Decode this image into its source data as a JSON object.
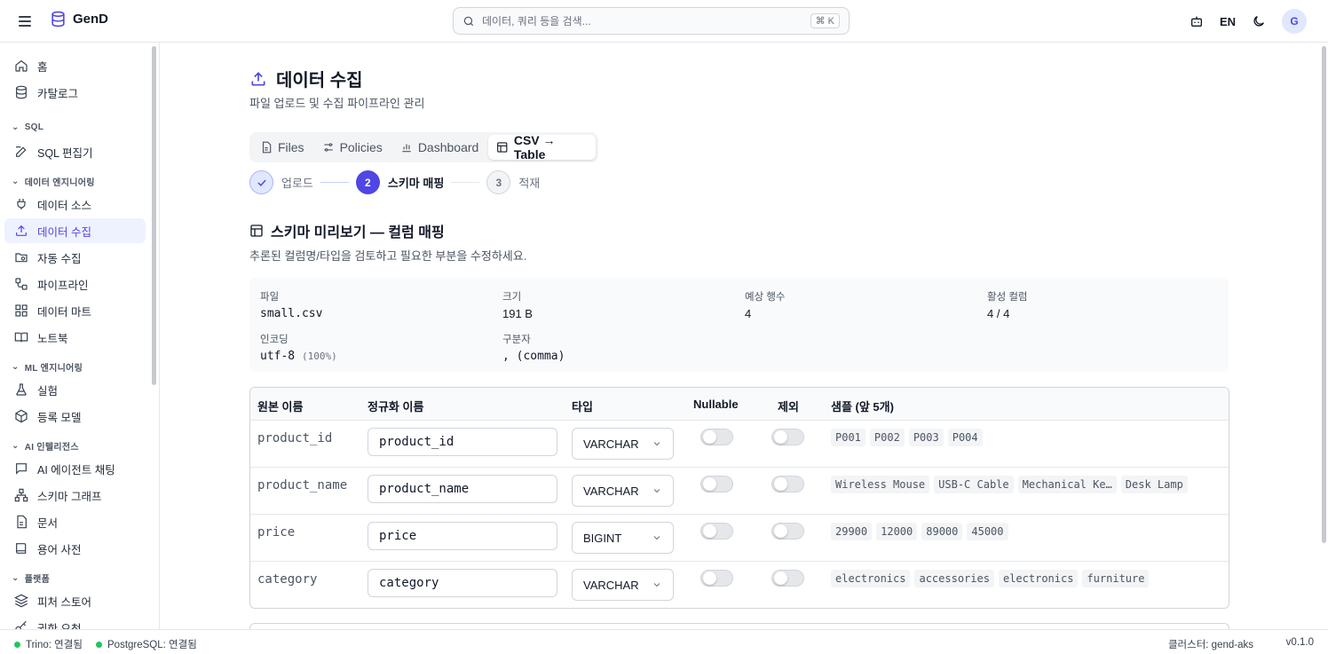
{
  "app": {
    "name": "GenD"
  },
  "search": {
    "placeholder": "데이터, 쿼리 등을 검색...",
    "shortcut": "⌘ K"
  },
  "header": {
    "lang": "EN",
    "avatar": "G"
  },
  "sidebar": {
    "items_top": [
      {
        "label": "홈"
      },
      {
        "label": "카탈로그"
      }
    ],
    "sections": [
      {
        "label": "SQL",
        "items": [
          {
            "label": "SQL 편집기"
          }
        ]
      },
      {
        "label": "데이터 엔지니어링",
        "items": [
          {
            "label": "데이터 소스"
          },
          {
            "label": "데이터 수집"
          },
          {
            "label": "자동 수집"
          },
          {
            "label": "파이프라인"
          },
          {
            "label": "데이터 마트"
          },
          {
            "label": "노트북"
          }
        ]
      },
      {
        "label": "ML 엔지니어링",
        "items": [
          {
            "label": "실험"
          },
          {
            "label": "등록 모델"
          }
        ]
      },
      {
        "label": "AI 인텔리전스",
        "items": [
          {
            "label": "AI 에이전트 채팅"
          },
          {
            "label": "스키마 그래프"
          },
          {
            "label": "문서"
          },
          {
            "label": "용어 사전"
          }
        ]
      },
      {
        "label": "플랫폼",
        "items": [
          {
            "label": "피처 스토어"
          },
          {
            "label": "권한 요청"
          }
        ]
      }
    ]
  },
  "page": {
    "title": "데이터 수집",
    "subtitle": "파일 업로드 및 수집 파이프라인 관리"
  },
  "tabs": [
    {
      "label": "Files"
    },
    {
      "label": "Policies"
    },
    {
      "label": "Dashboard"
    },
    {
      "label": "CSV → Table"
    }
  ],
  "stepper": [
    {
      "num": "",
      "label": "업로드"
    },
    {
      "num": "2",
      "label": "스키마 매핑"
    },
    {
      "num": "3",
      "label": "적재"
    }
  ],
  "section": {
    "title": "스키마 미리보기 — 컬럼 매핑",
    "subtitle": "추론된 컬럼명/타입을 검토하고 필요한 부분을 수정하세요."
  },
  "info": {
    "file": {
      "label": "파일",
      "value": "small.csv"
    },
    "size": {
      "label": "크기",
      "value": "191 B"
    },
    "rows": {
      "label": "예상 행수",
      "value": "4"
    },
    "active": {
      "label": "활성 컬럼",
      "value": "4 / 4"
    },
    "encoding": {
      "label": "인코딩",
      "value": "utf-8",
      "conf": "(100%)"
    },
    "delimiter": {
      "label": "구분자",
      "value": ", (comma)"
    }
  },
  "table": {
    "headers": {
      "orig": "원본 이름",
      "norm": "정규화 이름",
      "type": "타입",
      "nullable": "Nullable",
      "exclude": "제외",
      "sample": "샘플 (앞 5개)"
    },
    "rows": [
      {
        "orig": "product_id",
        "norm": "product_id",
        "type": "VARCHAR",
        "nullable": false,
        "exclude": false,
        "samples": [
          "P001",
          "P002",
          "P003",
          "P004"
        ]
      },
      {
        "orig": "product_name",
        "norm": "product_name",
        "type": "VARCHAR",
        "nullable": false,
        "exclude": false,
        "samples": [
          "Wireless Mouse",
          "USB-C Cable",
          "Mechanical Ke…",
          "Desk Lamp"
        ]
      },
      {
        "orig": "price",
        "norm": "price",
        "type": "BIGINT",
        "nullable": false,
        "exclude": false,
        "samples": [
          "29900",
          "12000",
          "89000",
          "45000"
        ]
      },
      {
        "orig": "category",
        "norm": "category",
        "type": "VARCHAR",
        "nullable": false,
        "exclude": false,
        "samples": [
          "electronics",
          "accessories",
          "electronics",
          "furniture"
        ]
      }
    ]
  },
  "status": {
    "trino": "Trino: 연결됨",
    "postgres": "PostgreSQL: 연결됨",
    "cluster": "클러스터: gend-aks",
    "version": "v0.1.0"
  },
  "colors": {
    "accent": "#4f46e5",
    "ok": "#22c55e"
  }
}
